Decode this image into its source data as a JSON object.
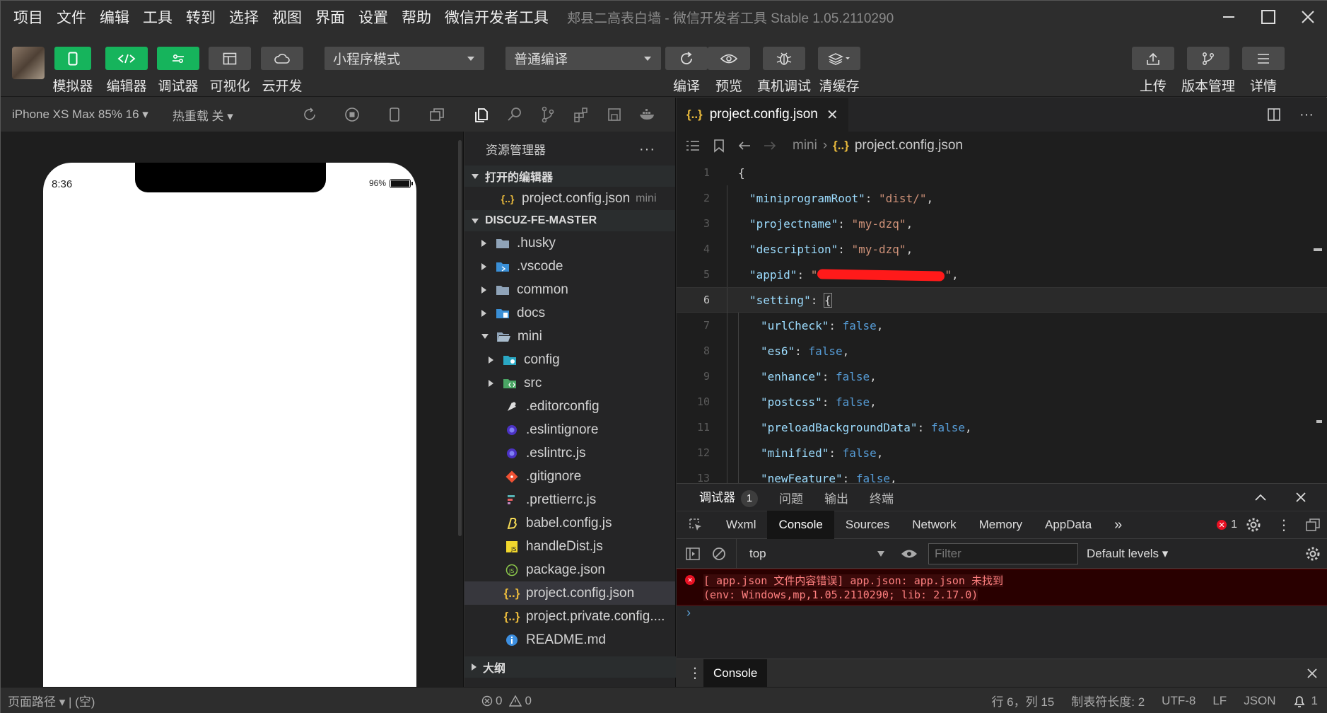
{
  "menubar": {
    "items": [
      "项目",
      "文件",
      "编辑",
      "工具",
      "转到",
      "选择",
      "视图",
      "界面",
      "设置",
      "帮助",
      "微信开发者工具"
    ],
    "window_title": "郏县二高表白墙 - 微信开发者工具 Stable 1.05.2110290"
  },
  "toolbar": {
    "left_buttons": [
      {
        "label": "模拟器",
        "icon": "phone-icon"
      },
      {
        "label": "编辑器",
        "icon": "code-icon"
      },
      {
        "label": "调试器",
        "icon": "debugger-icon"
      },
      {
        "label": "可视化",
        "icon": "layout-icon"
      },
      {
        "label": "云开发",
        "icon": "cloud-icon"
      }
    ],
    "mode_select": "小程序模式",
    "compile_select": "普通编译",
    "mid_buttons": [
      {
        "label": "编译",
        "icon": "refresh-icon"
      },
      {
        "label": "预览",
        "icon": "eye-icon"
      },
      {
        "label": "真机调试",
        "icon": "bug-icon"
      },
      {
        "label": "清缓存",
        "icon": "layers-icon"
      }
    ],
    "right_buttons": [
      {
        "label": "上传",
        "icon": "upload-icon"
      },
      {
        "label": "版本管理",
        "icon": "branch-icon"
      },
      {
        "label": "详情",
        "icon": "menu-icon"
      }
    ]
  },
  "simulator": {
    "device": "iPhone XS Max 85% 16",
    "hot_reload": "热重载 关",
    "time": "8:36",
    "battery": "96%"
  },
  "explorer": {
    "title": "资源管理器",
    "open_editors_label": "打开的编辑器",
    "open_editor": {
      "name": "project.config.json",
      "folder": "mini"
    },
    "root_label": "DISCUZ-FE-MASTER",
    "tree": [
      {
        "name": ".husky",
        "type": "folder",
        "depth": 0,
        "expanded": false
      },
      {
        "name": ".vscode",
        "type": "vscode",
        "depth": 0,
        "expanded": false
      },
      {
        "name": "common",
        "type": "folder",
        "depth": 0,
        "expanded": false
      },
      {
        "name": "docs",
        "type": "docs",
        "depth": 0,
        "expanded": false
      },
      {
        "name": "mini",
        "type": "folder-open",
        "depth": 0,
        "expanded": true
      },
      {
        "name": "config",
        "type": "config",
        "depth": 1,
        "expanded": false
      },
      {
        "name": "src",
        "type": "src",
        "depth": 1,
        "expanded": false
      },
      {
        "name": ".editorconfig",
        "type": "editorconfig",
        "depth": 1
      },
      {
        "name": ".eslintignore",
        "type": "eslint",
        "depth": 1
      },
      {
        "name": ".eslintrc.js",
        "type": "eslint",
        "depth": 1
      },
      {
        "name": ".gitignore",
        "type": "git",
        "depth": 1
      },
      {
        "name": ".prettierrc.js",
        "type": "prettier",
        "depth": 1
      },
      {
        "name": "babel.config.js",
        "type": "babel",
        "depth": 1
      },
      {
        "name": "handleDist.js",
        "type": "js",
        "depth": 1
      },
      {
        "name": "package.json",
        "type": "npm",
        "depth": 1
      },
      {
        "name": "project.config.json",
        "type": "json",
        "depth": 1,
        "selected": true
      },
      {
        "name": "project.private.config....",
        "type": "json",
        "depth": 1
      },
      {
        "name": "README.md",
        "type": "info",
        "depth": 1
      }
    ],
    "outline_label": "大纲"
  },
  "editor": {
    "tab_title": "project.config.json",
    "breadcrumb": [
      "mini",
      "project.config.json"
    ],
    "lines": [
      {
        "n": "1",
        "indent": 0,
        "key": "",
        "val": "",
        "text": "{"
      },
      {
        "n": "2",
        "indent": 1,
        "key": "\"miniprogramRoot\"",
        "val": "\"dist/\"",
        "end": ","
      },
      {
        "n": "3",
        "indent": 1,
        "key": "\"projectname\"",
        "val": "\"my-dzq\"",
        "end": ","
      },
      {
        "n": "4",
        "indent": 1,
        "key": "\"description\"",
        "val": "\"my-dzq\"",
        "end": ","
      },
      {
        "n": "5",
        "indent": 1,
        "key": "\"appid\"",
        "val": "redacted",
        "end": ","
      },
      {
        "n": "6",
        "indent": 1,
        "key": "\"setting\"",
        "val": "{",
        "end": "",
        "current": true
      },
      {
        "n": "7",
        "indent": 2,
        "key": "\"urlCheck\"",
        "val": "false",
        "end": ","
      },
      {
        "n": "8",
        "indent": 2,
        "key": "\"es6\"",
        "val": "false",
        "end": ","
      },
      {
        "n": "9",
        "indent": 2,
        "key": "\"enhance\"",
        "val": "false",
        "end": ","
      },
      {
        "n": "10",
        "indent": 2,
        "key": "\"postcss\"",
        "val": "false",
        "end": ","
      },
      {
        "n": "11",
        "indent": 2,
        "key": "\"preloadBackgroundData\"",
        "val": "false",
        "end": ","
      },
      {
        "n": "12",
        "indent": 2,
        "key": "\"minified\"",
        "val": "false",
        "end": ","
      },
      {
        "n": "13",
        "indent": 2,
        "key": "\"newFeature\"",
        "val": "false",
        "end": ","
      }
    ]
  },
  "debugger": {
    "panel_tabs": [
      "调试器",
      "问题",
      "输出",
      "终端"
    ],
    "debugger_badge": "1",
    "devtools_tabs": [
      "Wxml",
      "Console",
      "Sources",
      "Network",
      "Memory",
      "AppData"
    ],
    "active_tab": "Console",
    "error_count": "1",
    "context": "top",
    "filter_placeholder": "Filter",
    "levels": "Default levels",
    "error_line1": "[ app.json 文件内容错误] app.json: app.json 未找到",
    "error_line2": "(env: Windows,mp,1.05.2110290; lib: 2.17.0)",
    "drawer_tab": "Console"
  },
  "statusbar": {
    "page_path": "页面路径",
    "page_value": "(空)",
    "problems": "0",
    "warnings": "0",
    "position": "行 6，列 15",
    "tab_size": "制表符长度: 2",
    "encoding": "UTF-8",
    "eol": "LF",
    "language": "JSON",
    "notifications": "1"
  },
  "colors": {
    "green": "#16b45c",
    "error_bg": "#290000",
    "error_text": "#ff8080",
    "key": "#9cdcfe",
    "string": "#ce9178"
  }
}
